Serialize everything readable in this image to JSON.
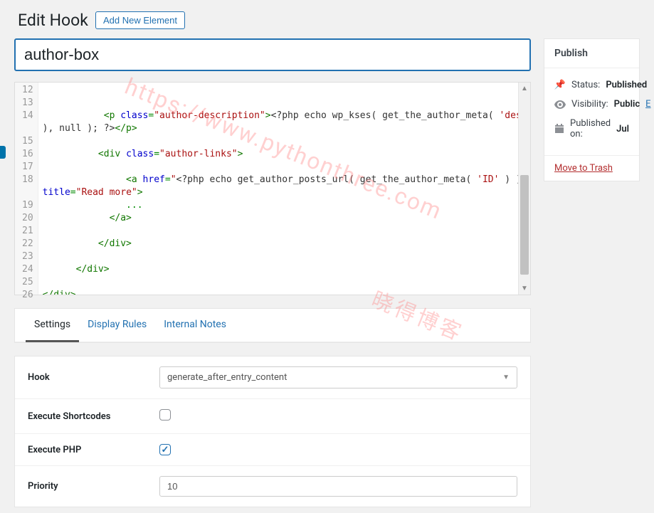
{
  "header": {
    "title": "Edit Hook",
    "add_button": "Add New Element"
  },
  "title_field": {
    "value": "author-box"
  },
  "code": {
    "line_start": 12,
    "line_end": 26,
    "lines": [
      "",
      "           <p class=\"author-description\"><?php echo wp_kses( get_the_author_meta( 'description' ), null ); ?></p>",
      "",
      "          <div class=\"author-links\">",
      "",
      "               <a href=\"<?php echo get_author_posts_url( get_the_author_meta( 'ID' ) ); ?>\" title=\"Read more\">",
      "               ...",
      "            </a>",
      "",
      "          </div>",
      "",
      "      </div>",
      "",
      "</div>"
    ]
  },
  "tabs": [
    {
      "label": "Settings",
      "active": true
    },
    {
      "label": "Display Rules",
      "active": false
    },
    {
      "label": "Internal Notes",
      "active": false
    }
  ],
  "settings": {
    "hook_label": "Hook",
    "hook_value": "generate_after_entry_content",
    "exec_shortcodes_label": "Execute Shortcodes",
    "exec_shortcodes_checked": false,
    "exec_php_label": "Execute PHP",
    "exec_php_checked": true,
    "priority_label": "Priority",
    "priority_value": "10"
  },
  "publish": {
    "box_title": "Publish",
    "status_label": "Status:",
    "status_value": "Published",
    "visibility_label": "Visibility:",
    "visibility_value": "Public",
    "visibility_edit": "E",
    "published_label": "Published on:",
    "published_value": "Jul",
    "trash": "Move to Trash"
  },
  "watermarks": {
    "w1": "https://www.pythonthree.com",
    "w2": "晓得博客"
  }
}
